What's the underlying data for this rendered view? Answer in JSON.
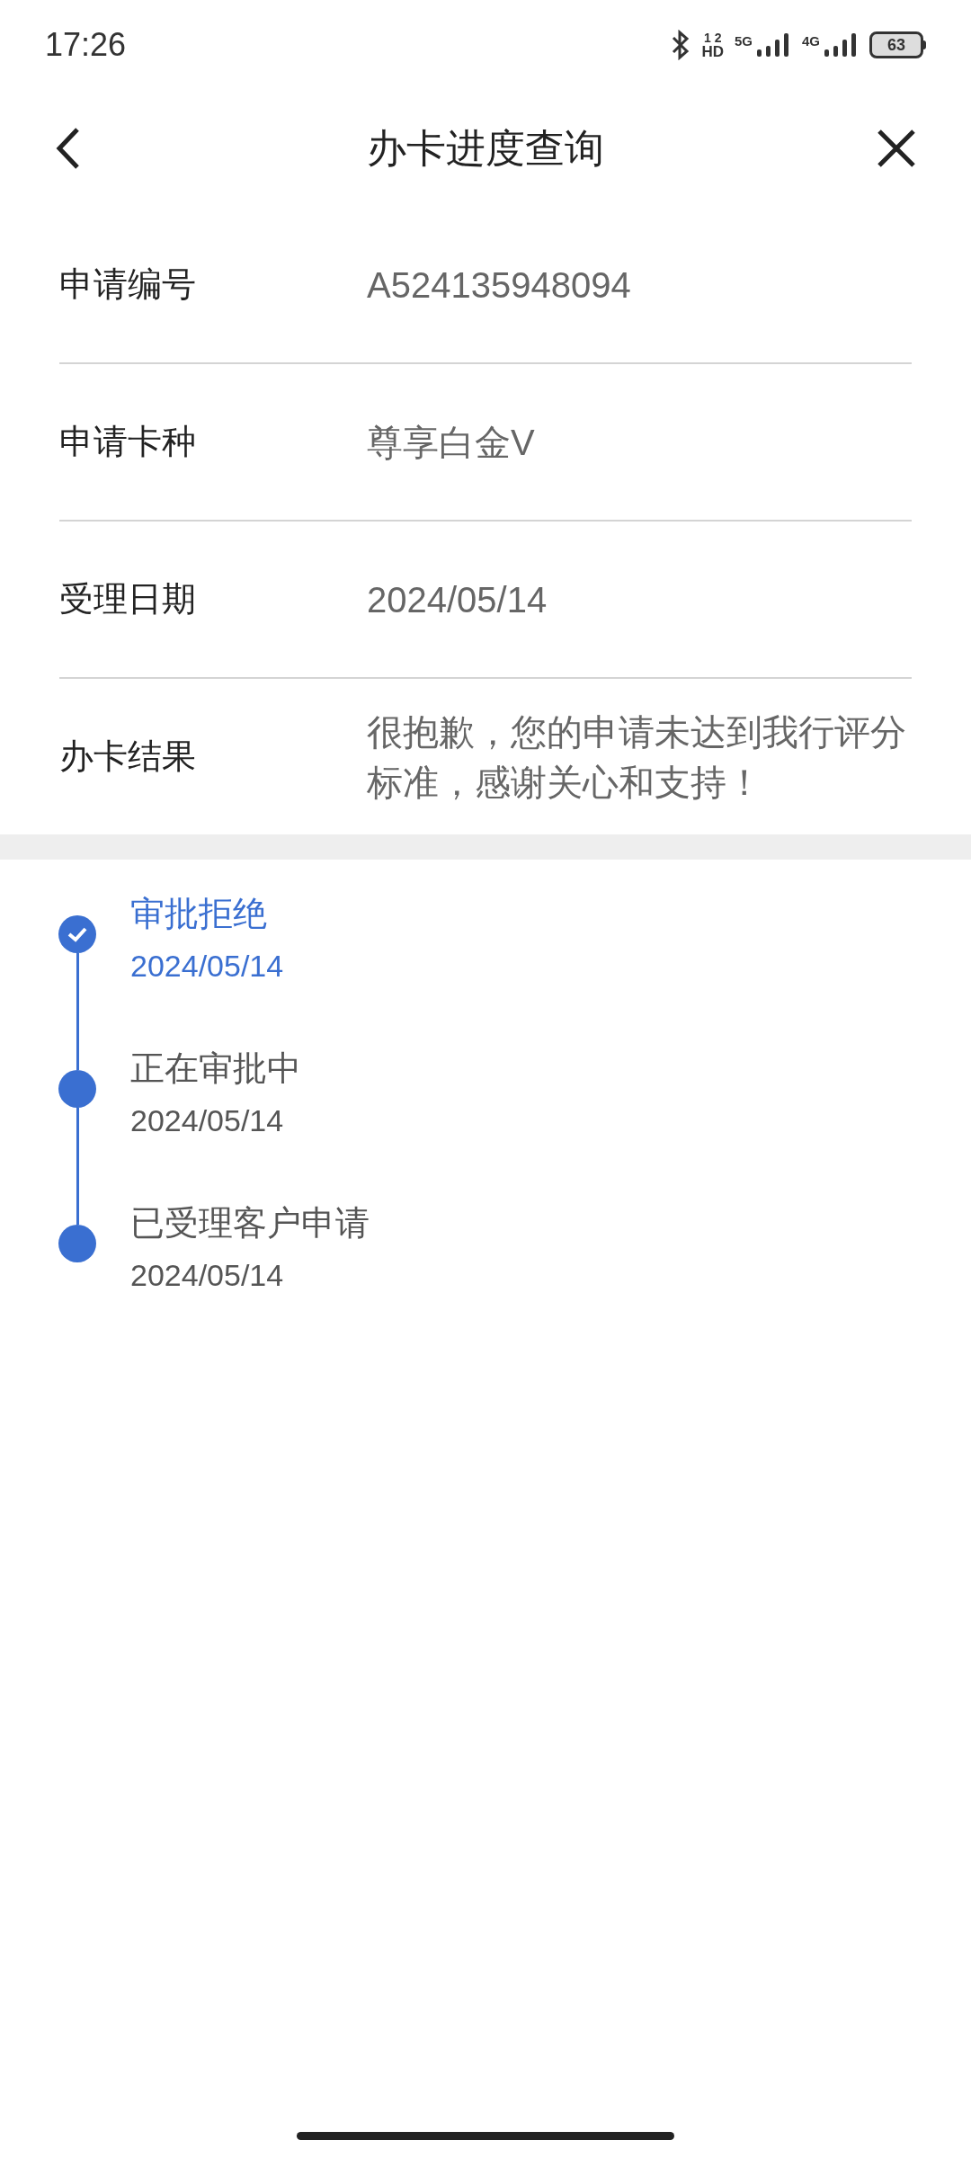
{
  "status_bar": {
    "time": "17:26",
    "hd_top": "1 2",
    "hd_bottom": "HD",
    "net_1": "5G",
    "net_2": "4G",
    "battery": "63"
  },
  "header": {
    "title": "办卡进度查询"
  },
  "details": [
    {
      "label": "申请编号",
      "value": "A524135948094"
    },
    {
      "label": "申请卡种",
      "value": "尊享白金V"
    },
    {
      "label": "受理日期",
      "value": "2024/05/14"
    },
    {
      "label": "办卡结果",
      "value": "很抱歉，您的申请未达到我行评分标准，感谢关心和支持！"
    }
  ],
  "timeline": [
    {
      "title": "审批拒绝",
      "date": "2024/05/14",
      "current": true
    },
    {
      "title": "正在审批中",
      "date": "2024/05/14",
      "current": false
    },
    {
      "title": "已受理客户申请",
      "date": "2024/05/14",
      "current": false
    }
  ]
}
